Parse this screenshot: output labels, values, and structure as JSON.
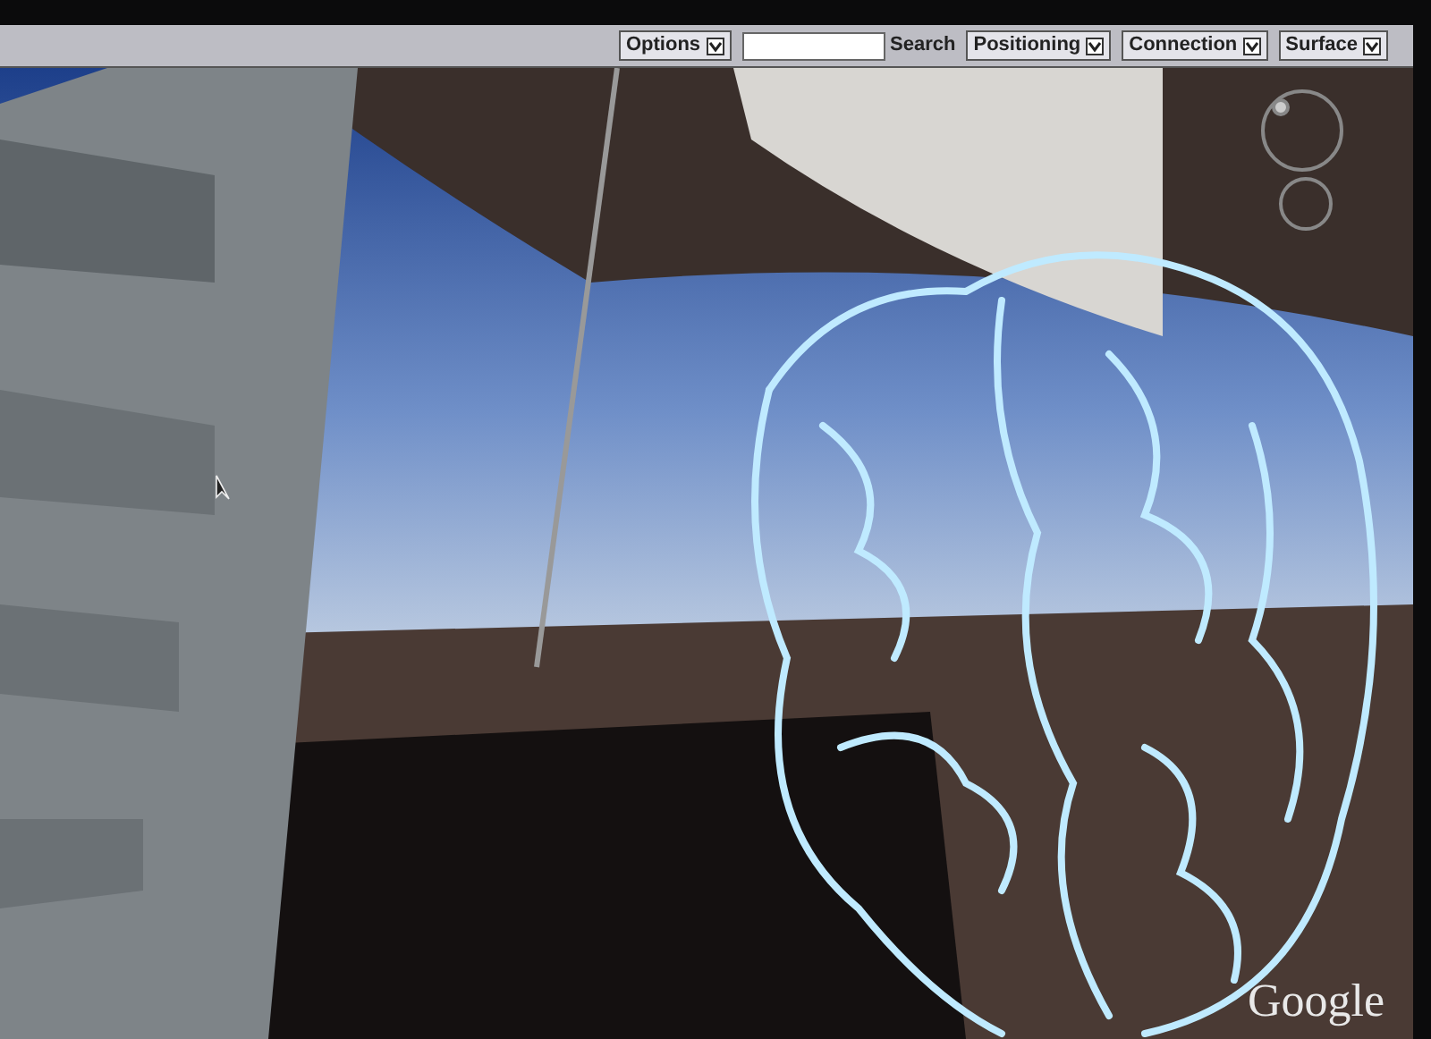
{
  "toolbar": {
    "items": [
      {
        "kind": "dropdown",
        "label": "Options"
      },
      {
        "kind": "search",
        "label": "Search"
      },
      {
        "kind": "dropdown",
        "label": "Positioning"
      },
      {
        "kind": "dropdown",
        "label": "Connection"
      },
      {
        "kind": "dropdown",
        "label": "Surface"
      }
    ]
  },
  "map": {
    "logo": "Google"
  }
}
